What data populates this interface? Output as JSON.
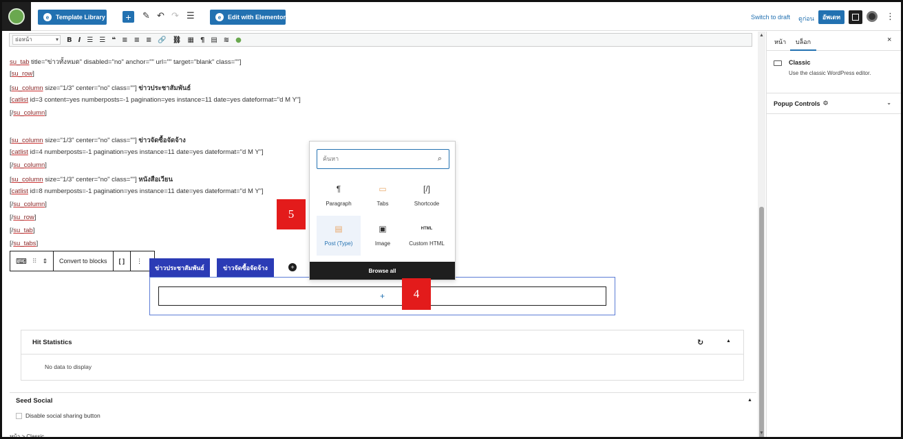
{
  "topbar": {
    "template_library_label": "Template Library",
    "add_block_symbol": "+",
    "edit_with_elementor_label": "Edit with Elementor",
    "switch_to_draft_label": "Switch to draft",
    "preview_label": "ดูก่อน",
    "publish_label": "อัพเดท"
  },
  "classic_toolbar": {
    "format_select_value": "ย่อหน้า",
    "buttons": [
      "B",
      "I",
      "☰",
      "☰",
      "❝",
      "≡",
      "≡",
      "≡",
      "🔗",
      "⛓",
      "▦",
      "¶",
      "▤",
      "≋",
      "●"
    ]
  },
  "content": {
    "lines": [
      {
        "pre": "",
        "sc": "su_tab",
        "post": " title=\"ข่าวทั้งหมด\" disabled=\"no\" anchor=\"\" url=\"\" target=\"blank\" class=\"\"]",
        "bold": ""
      },
      {
        "pre": "[",
        "sc": "su_row",
        "post": "]",
        "bold": ""
      },
      {
        "pre": "[",
        "sc": "su_column",
        "post": " size=\"1/3\" center=\"no\" class=\"\"] ",
        "bold": "ข่าวประชาสัมพันธ์"
      },
      {
        "pre": "[",
        "sc": "catlist",
        "post": " id=3 content=yes numberposts=-1 pagination=yes instance=11 date=yes dateformat=\"d M Y\"]",
        "bold": ""
      },
      {
        "pre": "[/",
        "sc": "su_column",
        "post": "]",
        "bold": ""
      },
      {
        "pre": "",
        "sc": "",
        "post": "",
        "bold": ""
      },
      {
        "pre": "[",
        "sc": "su_column",
        "post": " size=\"1/3\" center=\"no\" class=\"\"] ",
        "bold": "ข่าวจัดซื้อจัดจ้าง"
      },
      {
        "pre": "[",
        "sc": "catlist",
        "post": " id=4 numberposts=-1 pagination=yes instance=11 date=yes dateformat=\"d M Y\"]",
        "bold": ""
      },
      {
        "pre": "[/",
        "sc": "su_column",
        "post": "]",
        "bold": ""
      },
      {
        "pre": "[",
        "sc": "su_column",
        "post": " size=\"1/3\" center=\"no\" class=\"\"] ",
        "bold": "หนังสือเวียน"
      },
      {
        "pre": "[",
        "sc": "catlist",
        "post": " id=8 numberposts=-1 pagination=yes instance=11 date=yes dateformat=\"d M Y\"]",
        "bold": ""
      },
      {
        "pre": "[/",
        "sc": "su_column",
        "post": "]",
        "bold": ""
      },
      {
        "pre": "[/",
        "sc": "su_row",
        "post": "]",
        "bold": ""
      },
      {
        "pre": "[/",
        "sc": "su_tab",
        "post": "]",
        "bold": ""
      },
      {
        "pre": "[/",
        "sc": "su_tabs",
        "post": "]",
        "bold": ""
      }
    ]
  },
  "block_toolbar": {
    "convert_label": "Convert to blocks",
    "shortcode_glyph": "[ ]"
  },
  "tabs": {
    "tab1": "ข่าวประชาสัมพันธ์",
    "tab2": "ข่าวจัดซื้อจัดจ้าง",
    "appender_symbol": "+"
  },
  "inserter": {
    "search_placeholder": "ค้นหา",
    "items": [
      {
        "label": "Paragraph",
        "glyph": "¶"
      },
      {
        "label": "Tabs",
        "glyph": "▭"
      },
      {
        "label": "Shortcode",
        "glyph": "[/]"
      },
      {
        "label": "Post (Type)",
        "glyph": "▤"
      },
      {
        "label": "Image",
        "glyph": "▣"
      },
      {
        "label": "Custom HTML",
        "glyph": "HTML"
      }
    ],
    "browse_all_label": "Browse all"
  },
  "markers": {
    "m4": "4",
    "m5": "5"
  },
  "meta": {
    "hit_title": "Hit Statistics",
    "hit_empty": "No data to display",
    "seed_title": "Seed Social",
    "seed_option": "Disable social sharing button"
  },
  "breadcrumb": "หน้า > Classic",
  "sidebar": {
    "tab_page": "หน้า",
    "tab_block": "บล็อก",
    "block_name": "Classic",
    "block_desc": "Use the classic WordPress editor.",
    "popup_controls": "Popup Controls"
  },
  "colors": {
    "accent": "#2271b1",
    "tab_bg": "#2b3bb5",
    "marker": "#e31b1b"
  }
}
